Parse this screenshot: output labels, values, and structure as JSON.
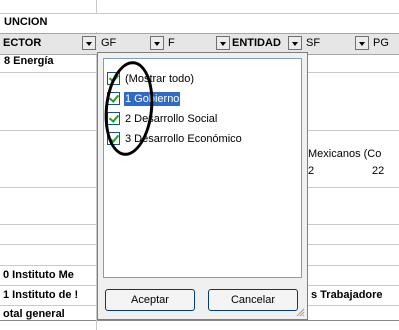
{
  "sheet": {
    "row_funcion": "UNCION",
    "fields": {
      "sector": "ECTOR",
      "gf": "GF",
      "f": "F",
      "entidad": "ENTIDAD",
      "sf": "SF",
      "pg": "PG"
    },
    "sector_value": "8 Energía",
    "mexicanos_text": "Mexicanos (Co",
    "num_left": "2",
    "num_right": "22",
    "row_bottom1": "0 Instituto Me",
    "row_bottom2": "1 Instituto de !",
    "row_bottom2_tail": "s Trabajadore",
    "row_total": "otal general"
  },
  "filter_panel": {
    "options": [
      {
        "label": "(Mostrar todo)",
        "checked": true,
        "selected": false
      },
      {
        "label": "1 Gobierno",
        "checked": true,
        "selected": true
      },
      {
        "label": "2 Desarrollo Social",
        "checked": true,
        "selected": false
      },
      {
        "label": "3 Desarrollo Económico",
        "checked": true,
        "selected": false
      }
    ],
    "accept_label": "Aceptar",
    "cancel_label": "Cancelar"
  },
  "colors": {
    "selection": "#316ac5",
    "check": "#21a121",
    "header_bg": "#e6e6e6"
  }
}
